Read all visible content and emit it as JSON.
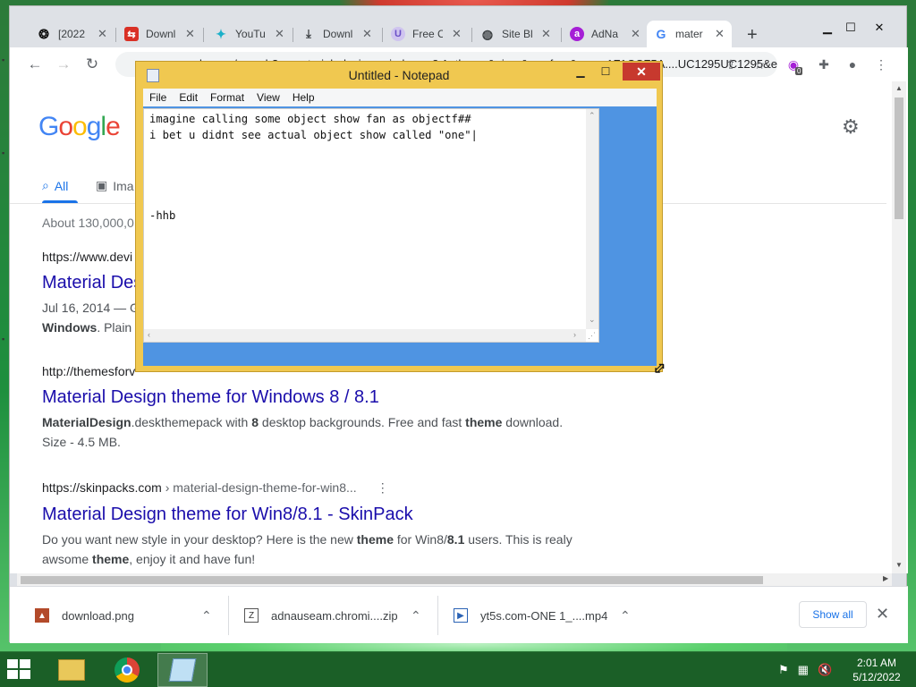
{
  "browser": {
    "tabs": [
      {
        "label": "[2022 I",
        "icon": "spiral-icon"
      },
      {
        "label": "Downl",
        "icon": "download-site-icon"
      },
      {
        "label": "YouTu",
        "icon": "youtube-icon"
      },
      {
        "label": "Downl",
        "icon": "download-icon"
      },
      {
        "label": "Free C",
        "icon": "ublock-icon"
      },
      {
        "label": "Site Bl",
        "icon": "globe-icon"
      },
      {
        "label": "AdNa",
        "icon": "adnauseam-icon"
      },
      {
        "label": "mater",
        "icon": "google-icon"
      }
    ],
    "tab_close": "✕",
    "new_tab": "+",
    "address": "www.google.com/search?q=material+design+windows+8.1+theme&ei=...&sxsrf=...&oq=...1F1CCF5A....UC1295UC1295&ei=...",
    "extension_badge": "0"
  },
  "google": {
    "logo": "Google",
    "tabs": {
      "all": "All",
      "images": "Ima"
    },
    "stats": "About 130,000,0",
    "results": [
      {
        "cite": "https://www.devi",
        "title": "Material Des",
        "snippet_date": "Jul 16, 2014 — Ga",
        "snippet_bold": "Windows",
        "snippet_rest": ". Plain fo"
      },
      {
        "cite": "http://themesforv",
        "title": "Material Design theme for Windows 8 / 8.1",
        "snippet_b1": "MaterialDesign",
        "snippet_t1": ".deskthemepack with ",
        "snippet_b2": "8",
        "snippet_t2": " desktop backgrounds. Free and fast ",
        "snippet_b3": "theme",
        "snippet_t3": " download.",
        "snippet_line2": "Size - 4.5 MB."
      },
      {
        "cite": "https://skinpacks.com",
        "cite_path": " › material-design-theme-for-win8...",
        "title": "Material Design theme for Win8/8.1 - SkinPack",
        "snippet_t1": "Do you want new style in your desktop? Here is the new ",
        "snippet_b1": "theme",
        "snippet_t2": " for Win8/",
        "snippet_b2": "8.1",
        "snippet_t3": " users. This is realy",
        "snippet_t4": "awsome ",
        "snippet_b3": "theme",
        "snippet_t5": ", enjoy it and have fun!"
      }
    ]
  },
  "downloads": {
    "items": [
      {
        "name": "download.png"
      },
      {
        "name": "adnauseam.chromi....zip"
      },
      {
        "name": "yt5s.com-ONE 1_....mp4"
      }
    ],
    "show_all": "Show all"
  },
  "notepad": {
    "title": "Untitled - Notepad",
    "menu": [
      "File",
      "Edit",
      "Format",
      "View",
      "Help"
    ],
    "content": "imagine calling some object show fan as objectf##\ni bet u didnt see actual object show called \"one\"|\n\n\n\n\n-hhb"
  },
  "taskbar": {
    "time": "2:01 AM",
    "date": "5/12/2022"
  },
  "colors": {
    "notepad_frame": "#f0c850",
    "notepad_client": "#4f94e2",
    "google_blue": "#1a73e8",
    "link": "#1a0dab",
    "taskbar": "#1b5f27"
  }
}
